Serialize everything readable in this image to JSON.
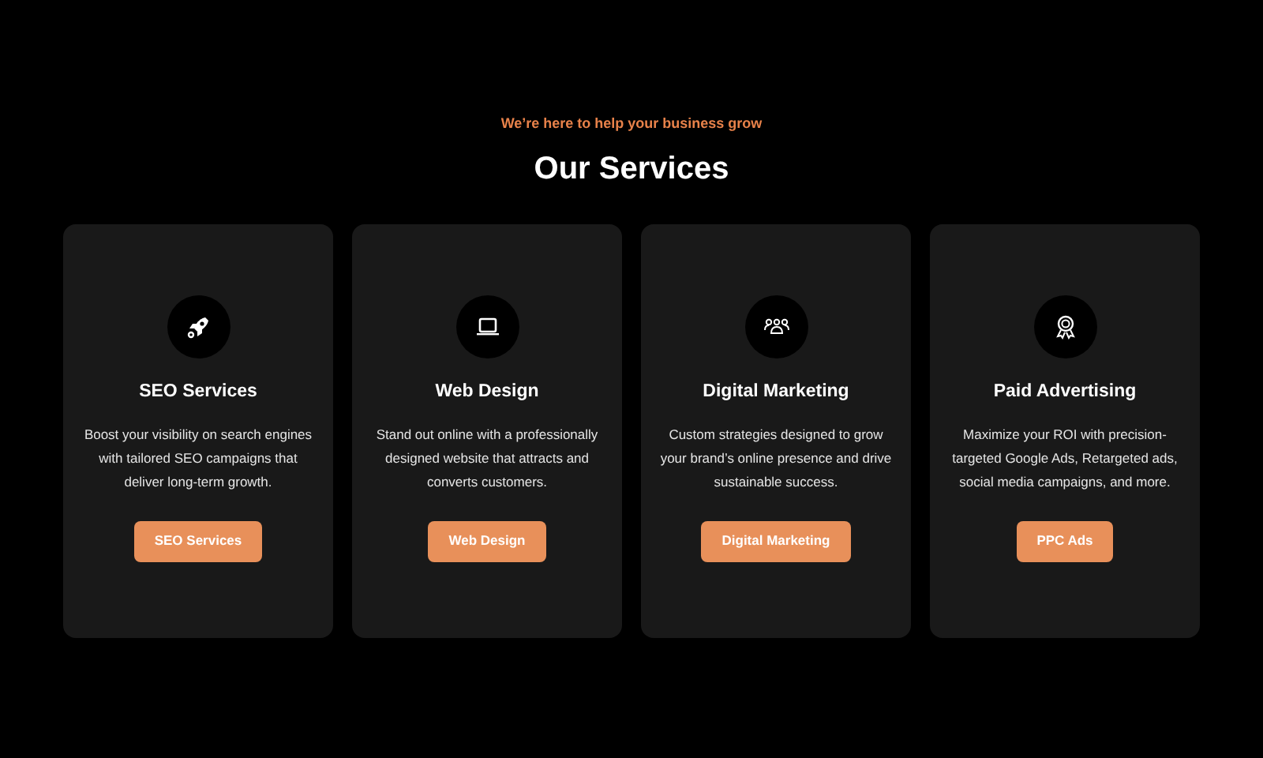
{
  "tagline": "We’re here to help your business grow",
  "heading": "Our Services",
  "services": [
    {
      "kind": "rocket",
      "title": "SEO Services",
      "description": "Boost your visibility on search engines with tailored SEO campaigns that deliver long-term growth.",
      "button": "SEO Services"
    },
    {
      "kind": "laptop",
      "title": "Web Design",
      "description": "Stand out online with a professionally designed website that attracts and converts customers.",
      "button": "Web Design"
    },
    {
      "kind": "people",
      "title": "Digital Marketing",
      "description": "Custom strategies designed to grow your brand’s online presence and drive sustainable success.",
      "button": "Digital Marketing"
    },
    {
      "kind": "award",
      "title": "Paid Advertising",
      "description": "Maximize your ROI with precision-targeted Google Ads, Retargeted ads, social media campaigns, and more.",
      "button": "PPC Ads"
    }
  ]
}
